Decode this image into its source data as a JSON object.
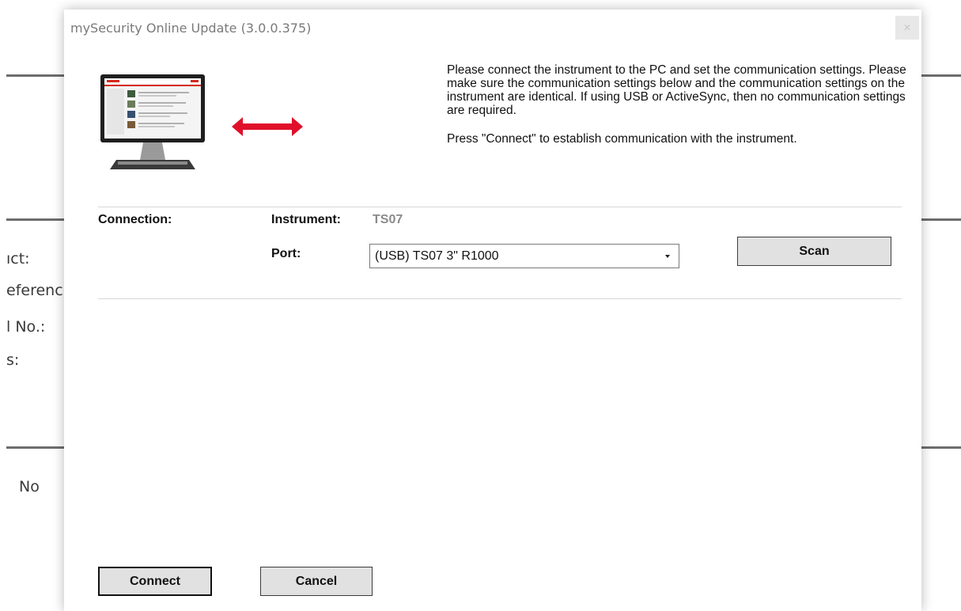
{
  "background": {
    "labels": [
      "ıct:",
      "eferenc",
      "l No.:",
      "s:",
      "No"
    ]
  },
  "dialog": {
    "title": "mySecurity Online Update (3.0.0.375)",
    "close_label": "✕",
    "info_paragraph_1": "Please connect the instrument to the PC and set the communication settings. Please make sure the communication settings below and the communication settings on the instrument are identical. If using USB or ActiveSync, then no communication settings are required.",
    "info_paragraph_2": "Press \"Connect\" to establish communication with the instrument.",
    "connection_label": "Connection:",
    "instrument_label": "Instrument:",
    "instrument_value": "TS07",
    "port_label": "Port:",
    "port_value": "(USB) TS07 3\" R1000",
    "scan_label": "Scan",
    "connect_label": "Connect",
    "cancel_label": "Cancel"
  },
  "colors": {
    "arrow": "#e0102a",
    "accent": "#d52b1e"
  }
}
